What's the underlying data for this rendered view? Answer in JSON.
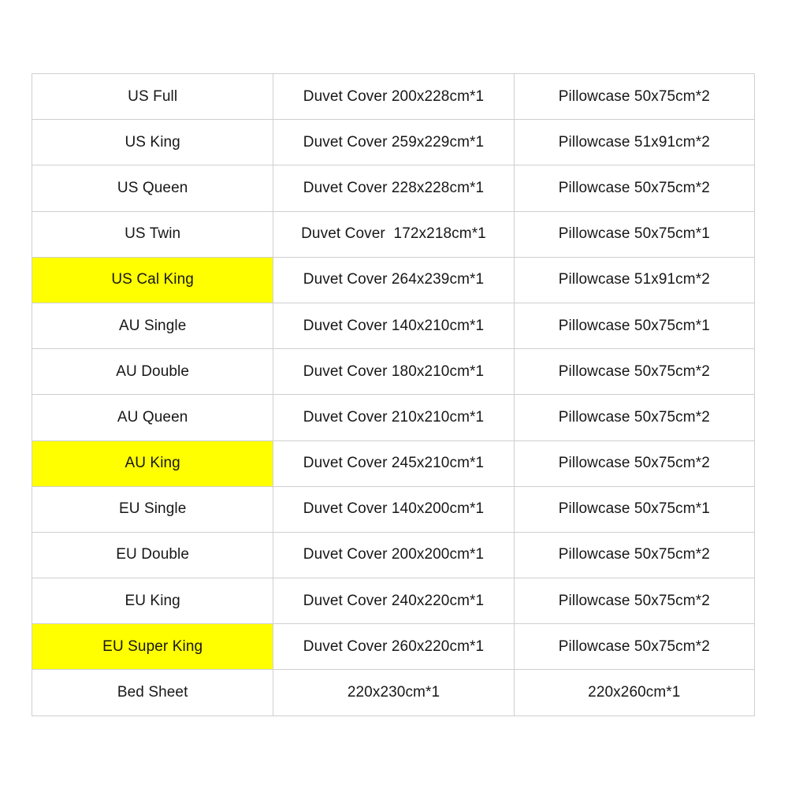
{
  "table": {
    "highlight_color": "#ffff00",
    "border_color": "#cfcfcf",
    "text_color": "#171717",
    "background_color": "#ffffff",
    "rows": [
      {
        "size": "US Full",
        "duvet": "Duvet Cover 200x228cm*1",
        "pillow": "Pillowcase 50x75cm*2",
        "highlight": false
      },
      {
        "size": "US King",
        "duvet": "Duvet Cover 259x229cm*1",
        "pillow": "Pillowcase 51x91cm*2",
        "highlight": false
      },
      {
        "size": "US Queen",
        "duvet": "Duvet Cover 228x228cm*1",
        "pillow": "Pillowcase 50x75cm*2",
        "highlight": false
      },
      {
        "size": "US Twin",
        "duvet": "Duvet Cover  172x218cm*1",
        "pillow": "Pillowcase 50x75cm*1",
        "highlight": false
      },
      {
        "size": "US Cal King",
        "duvet": "Duvet Cover 264x239cm*1",
        "pillow": "Pillowcase 51x91cm*2",
        "highlight": true
      },
      {
        "size": "AU Single",
        "duvet": "Duvet Cover 140x210cm*1",
        "pillow": "Pillowcase 50x75cm*1",
        "highlight": false
      },
      {
        "size": "AU Double",
        "duvet": "Duvet Cover 180x210cm*1",
        "pillow": "Pillowcase 50x75cm*2",
        "highlight": false
      },
      {
        "size": "AU Queen",
        "duvet": "Duvet Cover 210x210cm*1",
        "pillow": "Pillowcase 50x75cm*2",
        "highlight": false
      },
      {
        "size": "AU King",
        "duvet": "Duvet Cover 245x210cm*1",
        "pillow": "Pillowcase 50x75cm*2",
        "highlight": true
      },
      {
        "size": "EU Single",
        "duvet": "Duvet Cover 140x200cm*1",
        "pillow": "Pillowcase 50x75cm*1",
        "highlight": false
      },
      {
        "size": "EU Double",
        "duvet": "Duvet Cover 200x200cm*1",
        "pillow": "Pillowcase 50x75cm*2",
        "highlight": false
      },
      {
        "size": "EU King",
        "duvet": "Duvet Cover 240x220cm*1",
        "pillow": "Pillowcase 50x75cm*2",
        "highlight": false
      },
      {
        "size": "EU Super King",
        "duvet": "Duvet Cover 260x220cm*1",
        "pillow": "Pillowcase 50x75cm*2",
        "highlight": true
      },
      {
        "size": "Bed Sheet",
        "duvet": "220x230cm*1",
        "pillow": "220x260cm*1",
        "highlight": false
      }
    ]
  }
}
